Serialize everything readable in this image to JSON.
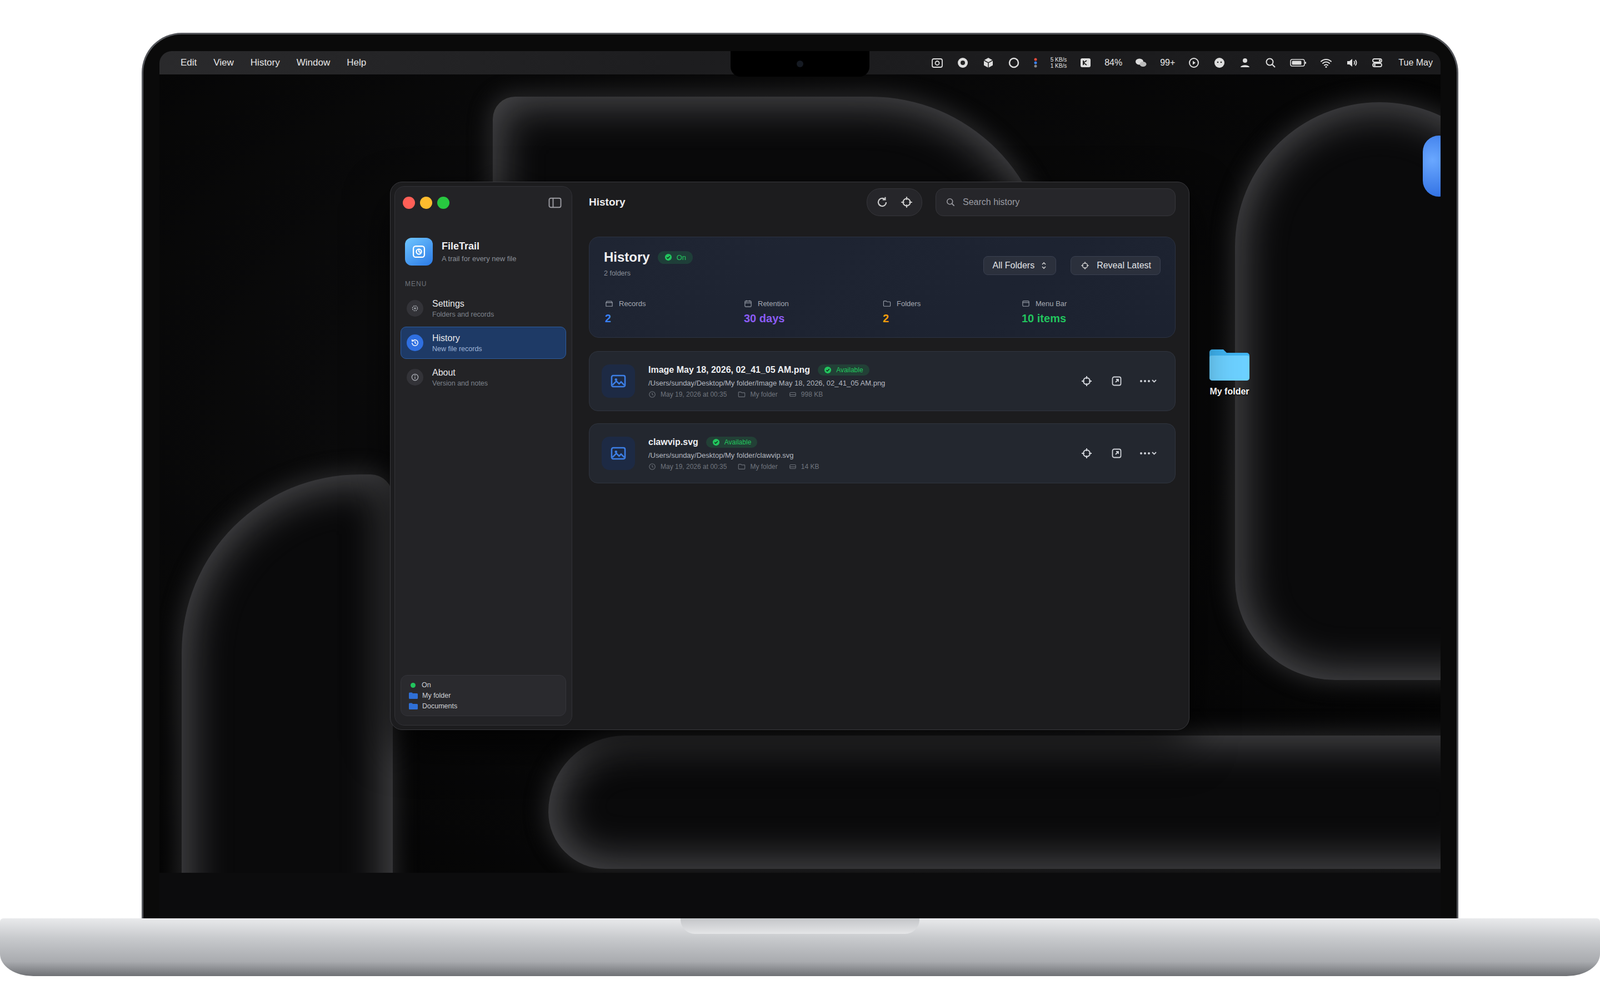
{
  "menu_bar": {
    "menus": [
      "Edit",
      "View",
      "History",
      "Window",
      "Help"
    ],
    "network_up": "5 KB/s",
    "network_down": "1 KB/s",
    "battery": "84%",
    "chat_badge": "99+",
    "clock": "Tue May"
  },
  "desktop_icons": [
    {
      "label": "My folder"
    }
  ],
  "app": {
    "name": "FileTrail",
    "tagline": "A trail for every new file"
  },
  "sidebar": {
    "section": "MENU",
    "items": [
      {
        "label": "Settings",
        "subtitle": "Folders and records",
        "kind": "settings",
        "selected": false
      },
      {
        "label": "History",
        "subtitle": "New file records",
        "kind": "history",
        "selected": true
      },
      {
        "label": "About",
        "subtitle": "Version and notes",
        "kind": "about",
        "selected": false
      }
    ],
    "status": {
      "label": "On",
      "on": true,
      "folders": [
        "My folder",
        "Documents"
      ]
    }
  },
  "toolbar": {
    "title": "History",
    "search_placeholder": "Search history"
  },
  "summary": {
    "title": "History",
    "badge": "On",
    "on": true,
    "subtitle": "2 folders",
    "filter": "All Folders",
    "button": "Reveal Latest",
    "stats": [
      {
        "label": "Records",
        "value": "2",
        "kind": "records",
        "color": "#3b82f6"
      },
      {
        "label": "Retention",
        "value": "30 days",
        "kind": "retention",
        "color": "#8b5cf6"
      },
      {
        "label": "Folders",
        "value": "2",
        "kind": "folders",
        "color": "#f59e0b"
      },
      {
        "label": "Menu Bar",
        "value": "10 items",
        "kind": "menubar",
        "color": "#22c55e"
      }
    ]
  },
  "records": [
    {
      "name": "Image May 18, 2026, 02_41_05 AM.png",
      "status": "Available",
      "available": true,
      "path": "/Users/sunday/Desktop/My folder/Image May 18, 2026, 02_41_05 AM.png",
      "date": "May 19, 2026 at 00:35",
      "folder": "My folder",
      "size": "998 KB"
    },
    {
      "name": "clawvip.svg",
      "status": "Available",
      "available": true,
      "path": "/Users/sunday/Desktop/My folder/clawvip.svg",
      "date": "May 19, 2026 at 00:35",
      "folder": "My folder",
      "size": "14 KB"
    }
  ]
}
